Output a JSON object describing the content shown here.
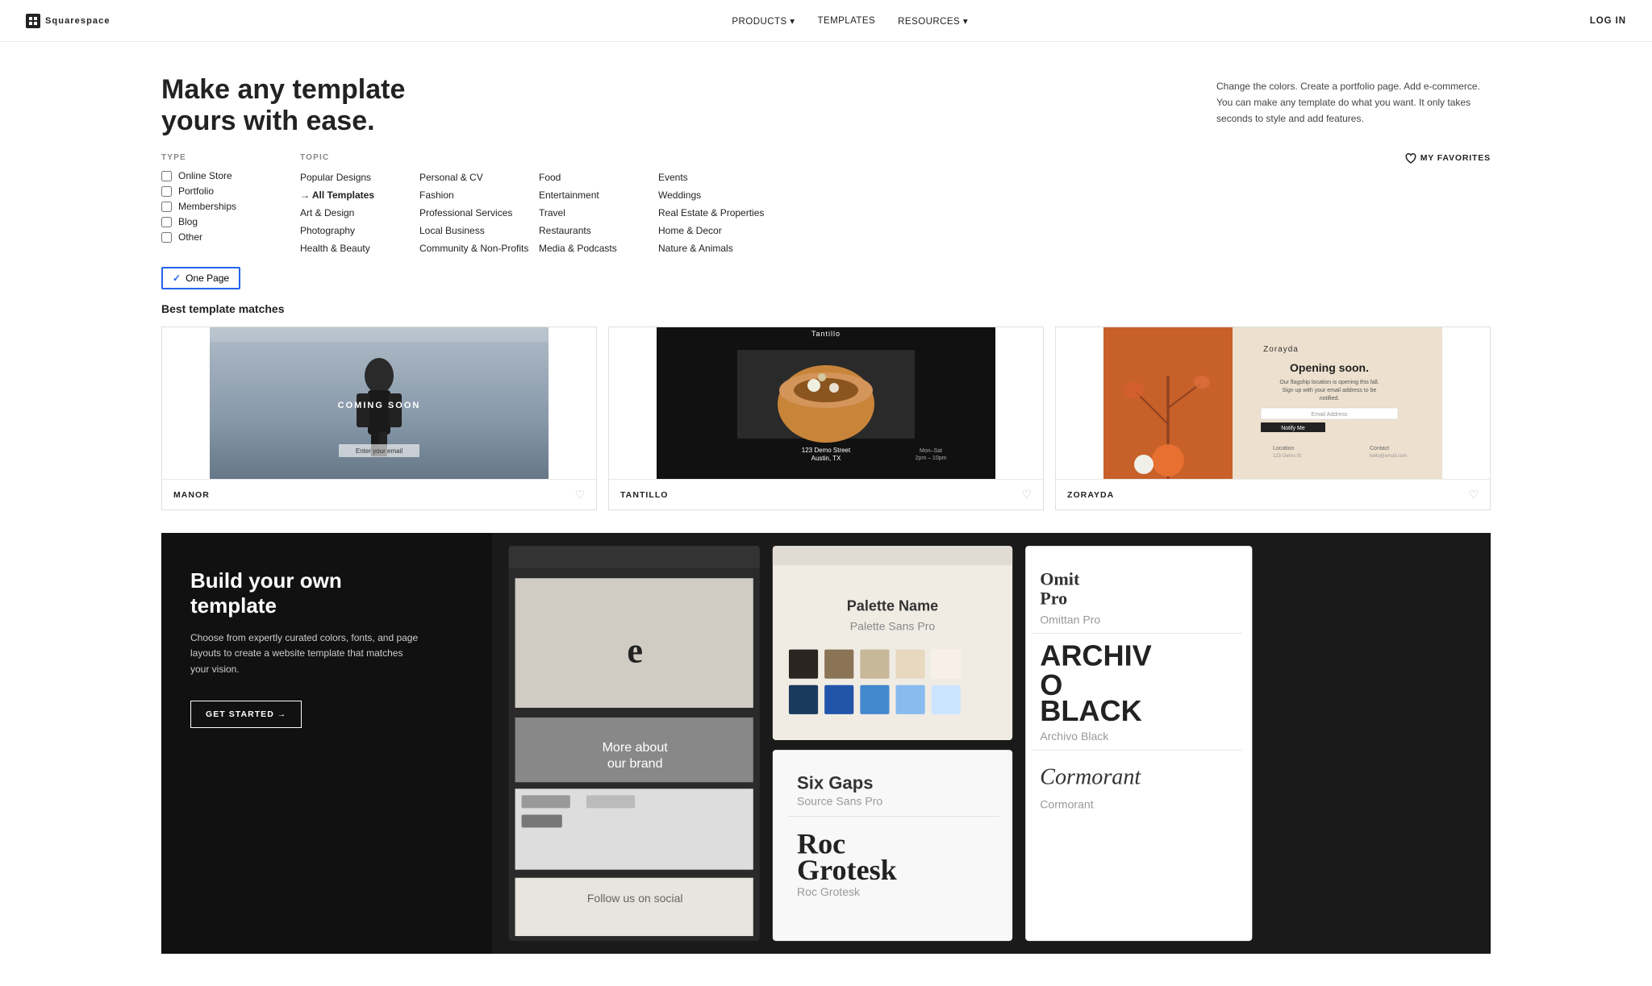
{
  "nav": {
    "logo": "Squarespace",
    "items": [
      {
        "label": "PRODUCTS",
        "hasDropdown": true
      },
      {
        "label": "TEMPLATES",
        "hasDropdown": false
      },
      {
        "label": "RESOURCES",
        "hasDropdown": true
      }
    ],
    "login": "LOG IN"
  },
  "hero": {
    "heading_line1": "Make any template",
    "heading_line2": "yours with ease.",
    "description": "Change the colors. Create a portfolio page. Add e-commerce. You can make any template do what you want. It only takes seconds to style and add features."
  },
  "filters": {
    "type_label": "TYPE",
    "topic_label": "TOPIC",
    "types": [
      {
        "label": "Online Store",
        "checked": false
      },
      {
        "label": "Portfolio",
        "checked": false
      },
      {
        "label": "Memberships",
        "checked": false
      },
      {
        "label": "Blog",
        "checked": false
      },
      {
        "label": "Other",
        "checked": false
      }
    ],
    "topics_col1": [
      {
        "label": "Popular Designs",
        "active": false,
        "arrow": false
      },
      {
        "label": "→ All Templates",
        "active": true,
        "arrow": false
      },
      {
        "label": "Art & Design",
        "active": false,
        "arrow": false
      },
      {
        "label": "Photography",
        "active": false,
        "arrow": false
      },
      {
        "label": "Health & Beauty",
        "active": false,
        "arrow": false
      }
    ],
    "topics_col2": [
      {
        "label": "Personal & CV",
        "active": false
      },
      {
        "label": "Fashion",
        "active": false
      },
      {
        "label": "Professional Services",
        "active": false
      },
      {
        "label": "Local Business",
        "active": false
      },
      {
        "label": "Community & Non-Profits",
        "active": false
      }
    ],
    "topics_col3": [
      {
        "label": "Food",
        "active": false
      },
      {
        "label": "Entertainment",
        "active": false
      },
      {
        "label": "Travel",
        "active": false
      },
      {
        "label": "Restaurants",
        "active": false
      },
      {
        "label": "Media & Podcasts",
        "active": false
      }
    ],
    "topics_col4": [
      {
        "label": "Events",
        "active": false
      },
      {
        "label": "Weddings",
        "active": false
      },
      {
        "label": "Real Estate & Properties",
        "active": false
      },
      {
        "label": "Home & Decor",
        "active": false
      },
      {
        "label": "Nature & Animals",
        "active": false
      }
    ],
    "active_tag": "One Page",
    "my_favorites": "MY FAVORITES"
  },
  "templates": {
    "section_title": "Best template matches",
    "items": [
      {
        "name": "MANOR",
        "id": "manor"
      },
      {
        "name": "TANTILLO",
        "id": "tantillo"
      },
      {
        "name": "ZORAYDA",
        "id": "zorayda"
      }
    ]
  },
  "build": {
    "heading_line1": "Build your own",
    "heading_line2": "template",
    "description": "Choose from expertly curated colors, fonts, and page layouts to create a website template that matches your vision.",
    "cta": "GET STARTED →"
  }
}
